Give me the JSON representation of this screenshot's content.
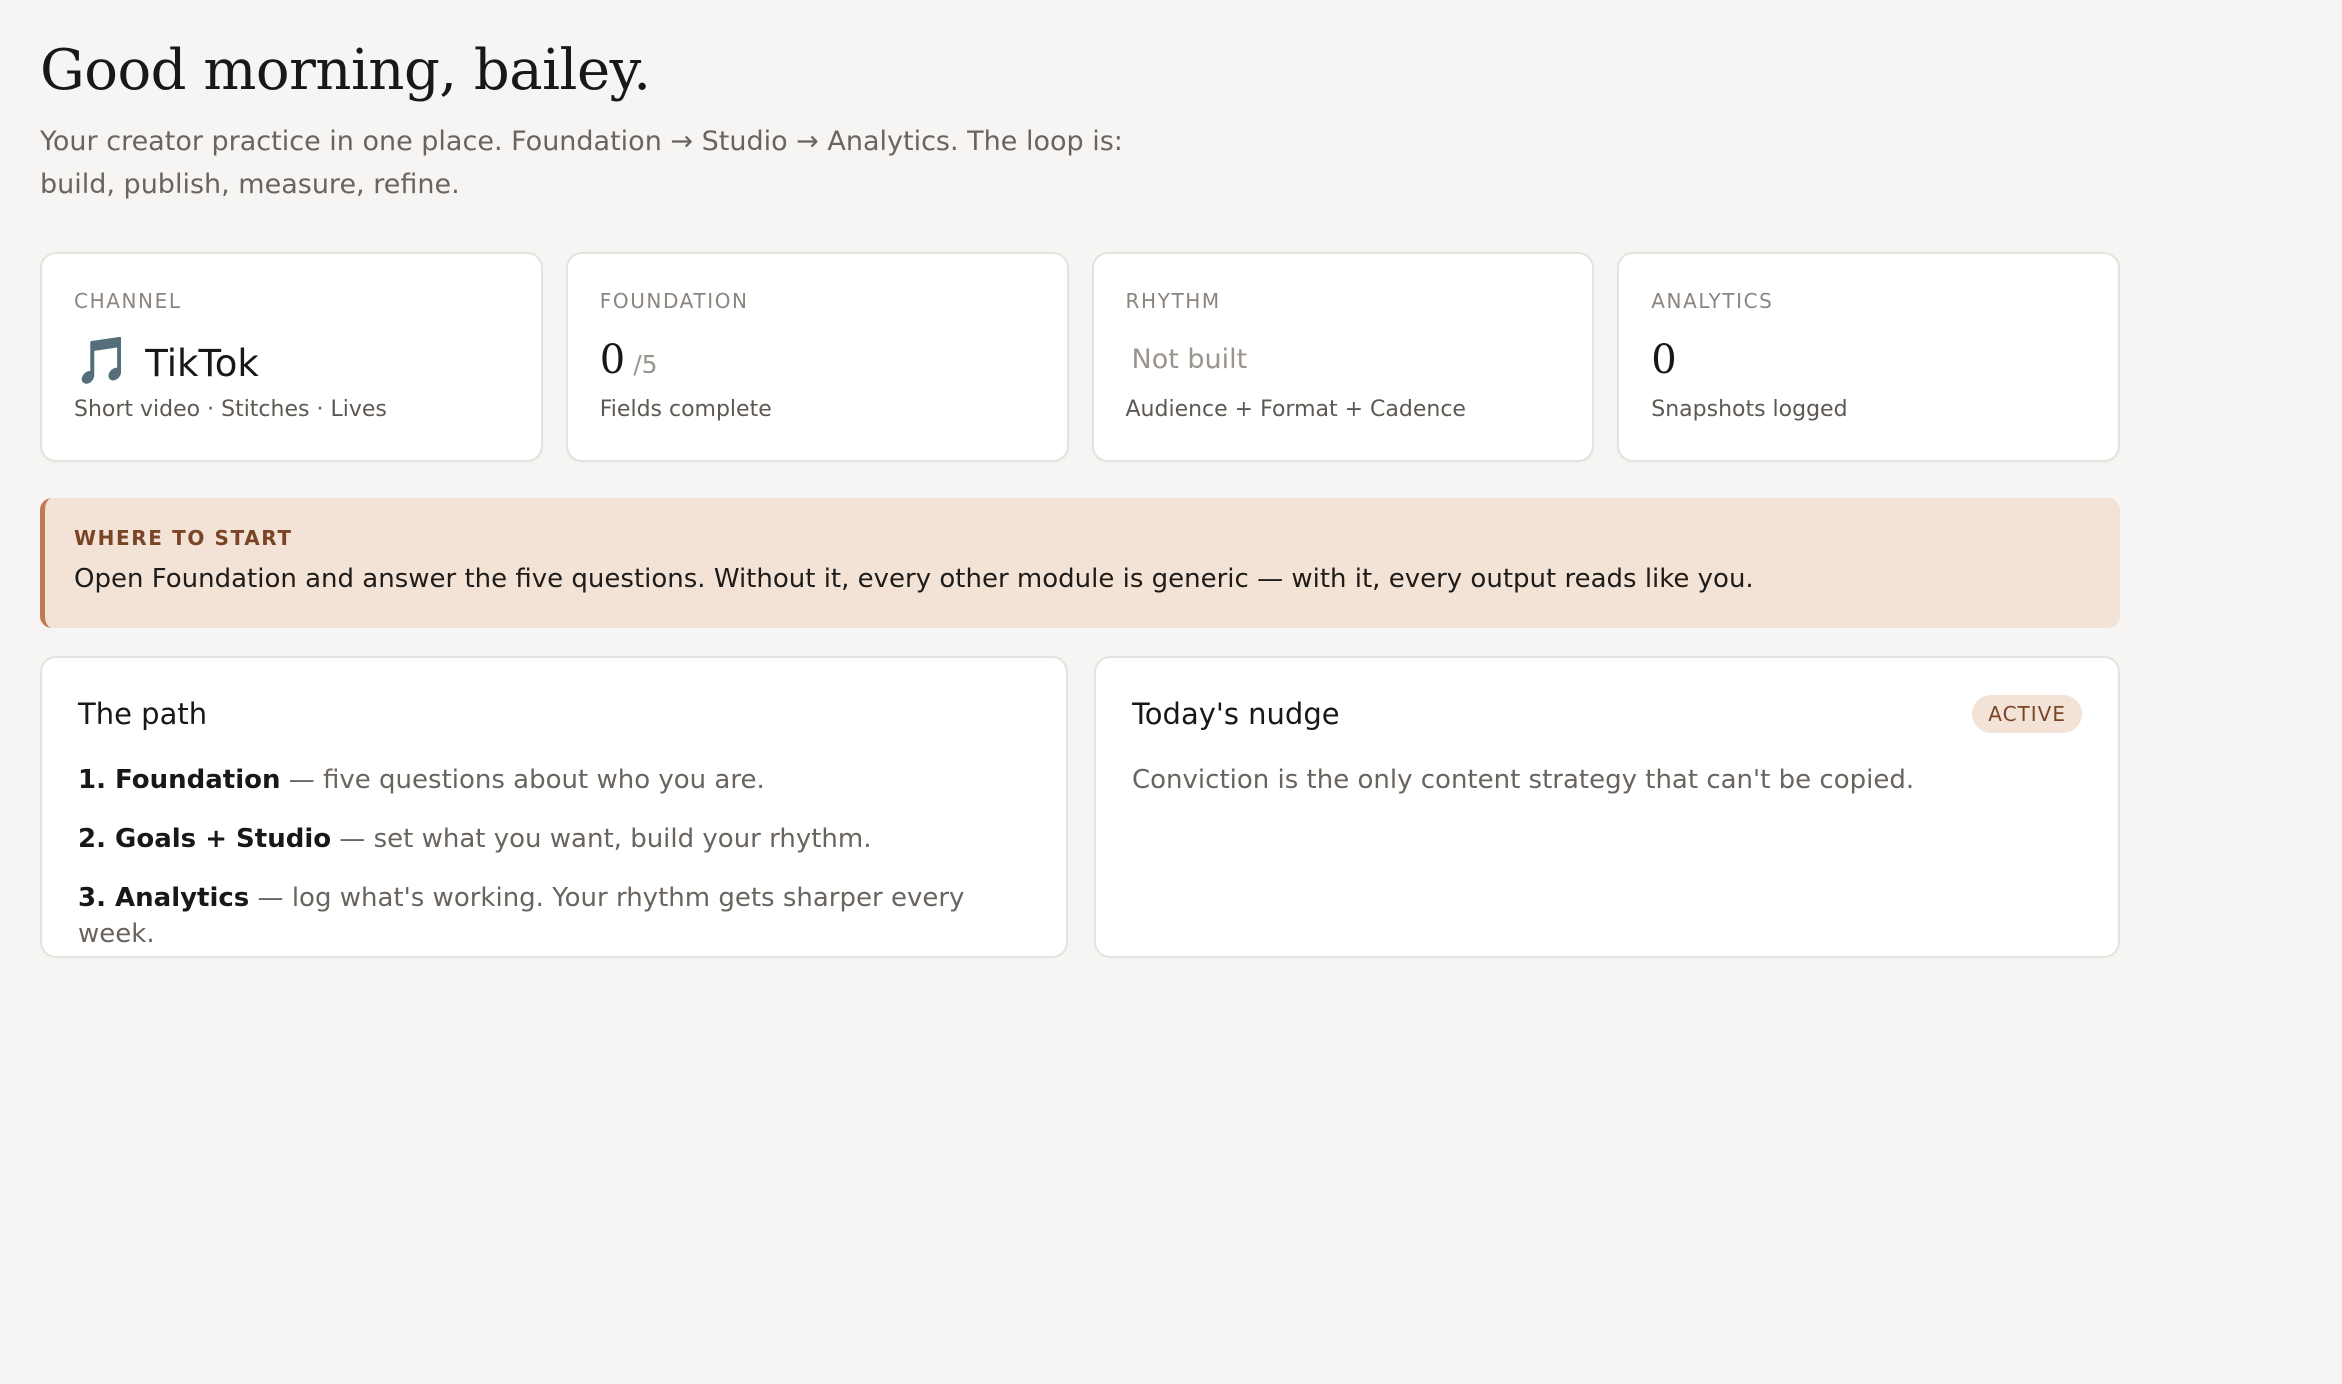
{
  "header": {
    "greeting": "Good morning, bailey.",
    "subtitle": "Your creator practice in one place. Foundation → Studio → Analytics. The loop is: build, publish, measure, refine."
  },
  "stats": {
    "channel": {
      "label": "CHANNEL",
      "icon": "music-note-icon",
      "icon_glyph": "🎵",
      "value": "TikTok",
      "sub": "Short video · Stitches · Lives"
    },
    "foundation": {
      "label": "FOUNDATION",
      "value": "0",
      "denominator": "/5",
      "sub": "Fields complete"
    },
    "rhythm": {
      "label": "RHYTHM",
      "value": "Not built",
      "sub": "Audience + Format + Cadence"
    },
    "analytics": {
      "label": "ANALYTICS",
      "value": "0",
      "sub": "Snapshots logged"
    }
  },
  "callout": {
    "label": "WHERE TO START",
    "text": "Open Foundation and answer the five questions. Without it, every other module is generic — with it, every output reads like you."
  },
  "path": {
    "title": "The path",
    "items": [
      {
        "strong": "1. Foundation",
        "rest": " — five questions about who you are."
      },
      {
        "strong": "2. Goals + Studio",
        "rest": " — set what you want, build your rhythm."
      },
      {
        "strong": "3. Analytics",
        "rest": " — log what's working. Your rhythm gets sharper every week."
      }
    ]
  },
  "nudge": {
    "title": "Today's nudge",
    "badge": "ACTIVE",
    "text": "Conviction is the only content strategy that can't be copied."
  },
  "colors": {
    "background": "#f6f5f3",
    "accent": "#c27a52",
    "callout_bg": "#f2e3d6",
    "badge_text": "#7a4526"
  }
}
